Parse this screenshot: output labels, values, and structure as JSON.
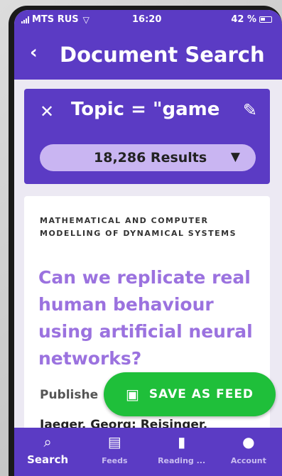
{
  "status_bar": {
    "carrier": "MTS RUS",
    "time": "16:20",
    "battery": "42 %"
  },
  "header": {
    "title": "Document Search",
    "back_icon": "chevron-left-icon"
  },
  "search_filter": {
    "clear_icon": "close-icon",
    "query": "Topic = \"game t",
    "edit_icon": "pencil-icon",
    "results_label": "18,286 Results",
    "filter_icon": "funnel-icon"
  },
  "result": {
    "journal": "MATHEMATICAL AND COMPUTER MODELLING OF DYNAMICAL SYSTEMS",
    "title": "Can we replicate real human behaviour using artificial neural networks?",
    "published_label": "Publishe",
    "authors": "Jaeger, Georg; Reisinger,"
  },
  "save_feed": {
    "label": "SAVE AS FEED",
    "icon": "floppy-disk-icon"
  },
  "bottom_nav": {
    "items": [
      {
        "label": "Search",
        "icon": "search-icon"
      },
      {
        "label": "Feeds",
        "icon": "feeds-icon"
      },
      {
        "label": "Reading ...",
        "icon": "bookmark-icon"
      },
      {
        "label": "Account",
        "icon": "account-icon"
      }
    ]
  },
  "colors": {
    "primary": "#5b3bc4",
    "title_accent": "#9b72df",
    "pill": "#c9b5f2",
    "save_button": "#1fbf3a"
  }
}
